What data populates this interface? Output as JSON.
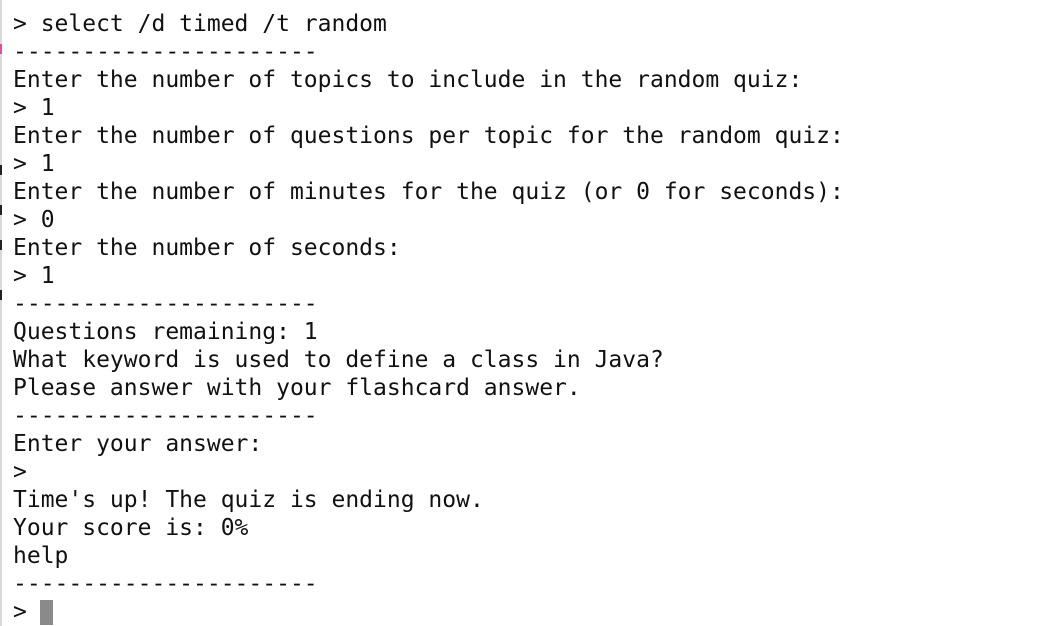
{
  "terminal": {
    "lines": [
      "> select /d timed /t random",
      "----------------------",
      "Enter the number of topics to include in the random quiz:",
      "> 1",
      "Enter the number of questions per topic for the random quiz:",
      "> 1",
      "Enter the number of minutes for the quiz (or 0 for seconds):",
      "> 0",
      "Enter the number of seconds:",
      "> 1",
      "----------------------",
      "Questions remaining: 1",
      "What keyword is used to define a class in Java?",
      "Please answer with your flashcard answer.",
      "----------------------",
      "Enter your answer:",
      ">",
      "Time's up! The quiz is ending now.",
      "Your score is: 0%",
      "help",
      "----------------------",
      ">"
    ],
    "colors": {
      "background": "#ffffff",
      "text": "#111111",
      "cursor": "#8a8a8a"
    }
  }
}
